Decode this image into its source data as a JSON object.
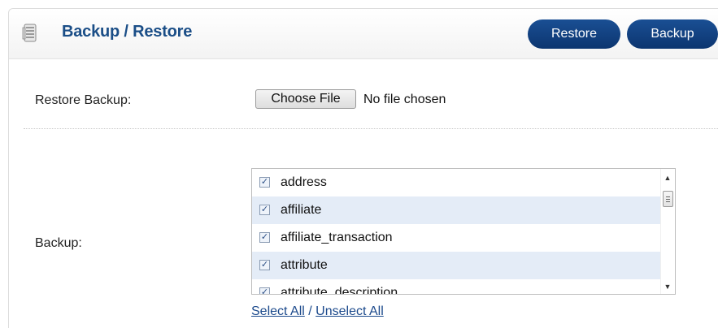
{
  "header": {
    "title": "Backup / Restore",
    "restore_button": "Restore",
    "backup_button": "Backup"
  },
  "restore_section": {
    "label": "Restore Backup:",
    "choose_file_label": "Choose File",
    "file_status": "No file chosen"
  },
  "backup_section": {
    "label": "Backup:",
    "tables": [
      {
        "name": "address",
        "checked": true
      },
      {
        "name": "affiliate",
        "checked": true
      },
      {
        "name": "affiliate_transaction",
        "checked": true
      },
      {
        "name": "attribute",
        "checked": true
      },
      {
        "name": "attribute_description",
        "checked": true
      }
    ],
    "select_all": "Select All",
    "separator": " / ",
    "unselect_all": "Unselect All"
  },
  "colors": {
    "button_bg": "#0f3f7f",
    "title": "#1b4e87",
    "row_alt": "#e4ecf7",
    "link": "#1c4a8c"
  }
}
